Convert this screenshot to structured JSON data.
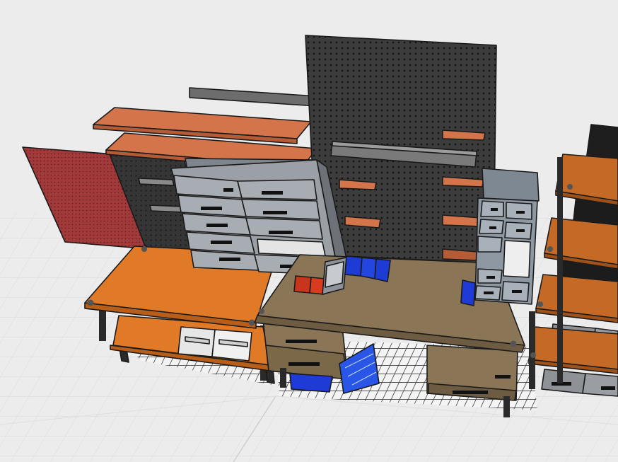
{
  "viewport": {
    "background": "#ececec",
    "floor_grid_color": "#d6d6d6"
  },
  "scene": {
    "objects": [
      {
        "name": "red-pegboard",
        "color": "#a13a3a"
      },
      {
        "name": "dark-pegboard",
        "color": "#3a3a3a"
      },
      {
        "name": "tall-pegboard",
        "color": "#3c3c3c"
      },
      {
        "name": "wood-shelf",
        "color": "#d4744a"
      },
      {
        "name": "steel-shelf",
        "color": "#6d6d6d"
      },
      {
        "name": "drawer-cabinet",
        "color": "#9aa0a6"
      },
      {
        "name": "orange-workbench",
        "color": "#e07a26"
      },
      {
        "name": "wood-workbench",
        "color": "#8a7656"
      },
      {
        "name": "small-parts-cabinet",
        "color": "#7d8893"
      },
      {
        "name": "blue-bin",
        "color": "#1e3bd6"
      },
      {
        "name": "red-bin",
        "color": "#c8341c"
      },
      {
        "name": "shelving-unit",
        "color": "#c46a26"
      },
      {
        "name": "black-box",
        "color": "#1e1e1e"
      },
      {
        "name": "grey-storage-bin",
        "color": "#9a9ea2"
      },
      {
        "name": "white-storage-bin",
        "color": "#e6e6e6"
      }
    ]
  }
}
